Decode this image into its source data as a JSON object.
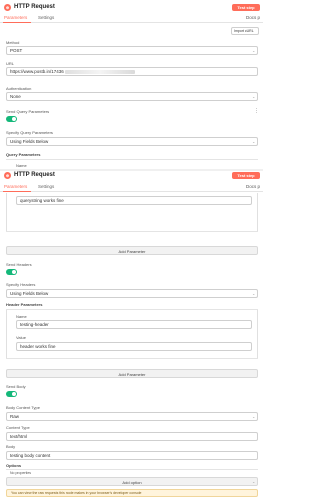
{
  "screen1": {
    "title": "HTTP Request",
    "test_step": "Test step",
    "tabs": [
      "Parameters",
      "Settings"
    ],
    "docs": "Docs p",
    "import_curl": "Import cURL",
    "method_label": "Method",
    "method_value": "POST",
    "url_label": "URL",
    "url_value": "https://www.postb.in/17436",
    "auth_label": "Authentication",
    "auth_value": "None",
    "send_query_label": "Send Query Parameters",
    "specify_query_label": "Specify Query Parameters",
    "specify_query_value": "Using Fields Below",
    "query_params_label": "Query Parameters",
    "name_label": "Name"
  },
  "screen2": {
    "title": "HTTP Request",
    "test_step": "Test step",
    "tabs": [
      "Parameters",
      "Settings"
    ],
    "docs": "Docs p",
    "query_value": "querystring works fine",
    "add_parameter": "Add Parameter",
    "send_headers_label": "Send Headers",
    "specify_headers_label": "Specify Headers",
    "specify_headers_value": "Using Fields Below",
    "header_params_label": "Header Parameters",
    "header_name_label": "Name",
    "header_name_value": "testing-header",
    "header_value_label": "Value",
    "header_value_value": "header works fine",
    "add_parameter_2": "Add Parameter",
    "send_body_label": "Send Body",
    "body_content_type_label": "Body Content Type",
    "body_content_type_value": "Raw",
    "content_type_label": "Content Type",
    "content_type_value": "text/html",
    "body_label": "Body",
    "body_value": "testing body content",
    "options_label": "Options",
    "no_properties": "No properties",
    "add_option": "Add option",
    "warning": "You can view the raw requests this node makes in your browser's developer console"
  },
  "colors": {
    "accent": "#ff6d5a",
    "toggle_on": "#14b87a",
    "warning_bg": "#fff4dc"
  }
}
